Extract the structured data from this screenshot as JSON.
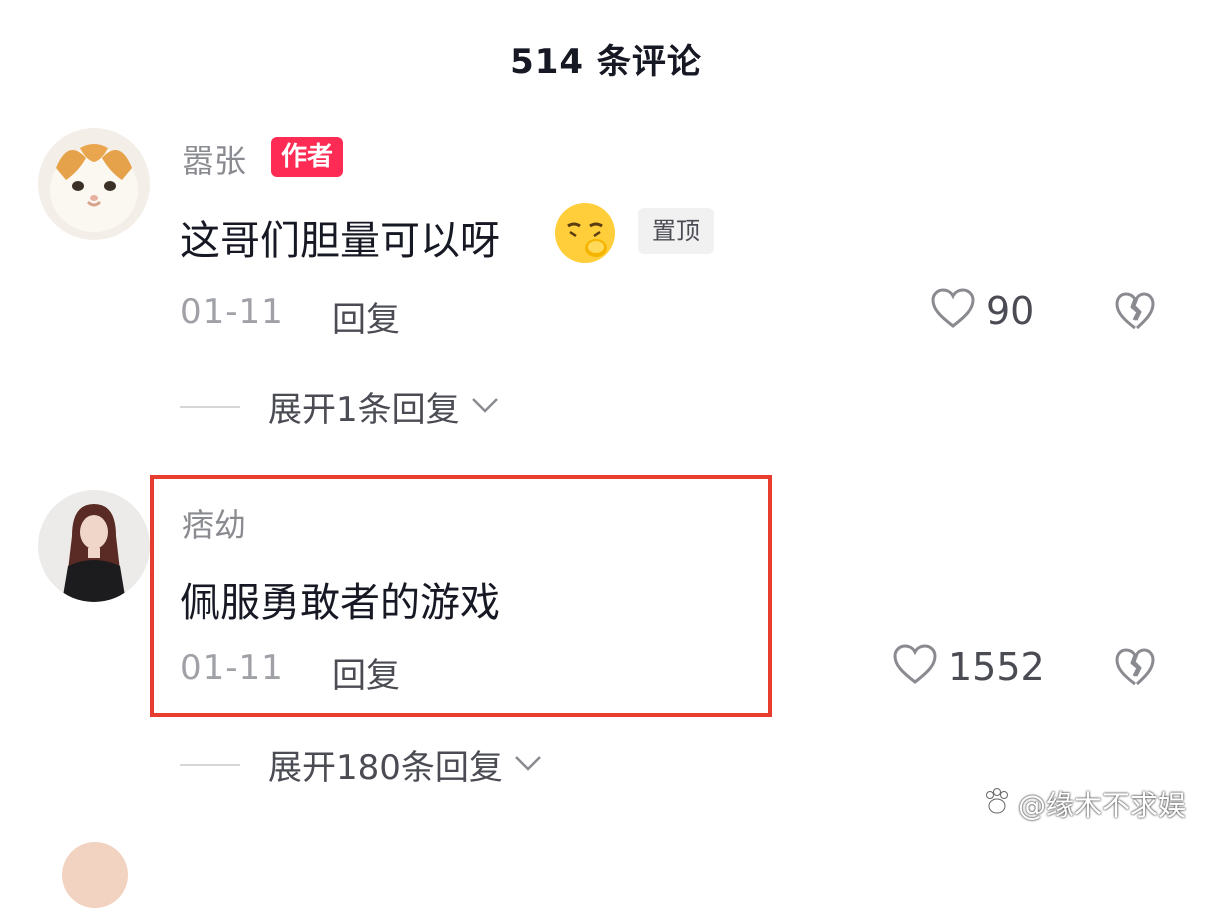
{
  "header": {
    "title": "514 条评论"
  },
  "comments": [
    {
      "username": "嚣张",
      "author_badge": "作者",
      "text": "这哥们胆量可以呀",
      "emoji": "pleading-covering-mouth-emoji",
      "pinned_label": "置顶",
      "date": "01-11",
      "reply_label": "回复",
      "like_count": "90",
      "expand_label": "展开1条回复"
    },
    {
      "username": "痞幼",
      "text": "佩服勇敢者的游戏",
      "date": "01-11",
      "reply_label": "回复",
      "like_count": "1552",
      "expand_label": "展开180条回复",
      "highlighted": true
    }
  ],
  "watermark": {
    "text": "@缘木不求娱"
  },
  "colors": {
    "brand_red": "#fe2c55",
    "highlight_border": "#e83c2f",
    "secondary_text": "#8a8b91"
  },
  "icons": [
    "heart-icon",
    "broken-heart-icon",
    "chevron-down-icon",
    "paw-icon"
  ]
}
